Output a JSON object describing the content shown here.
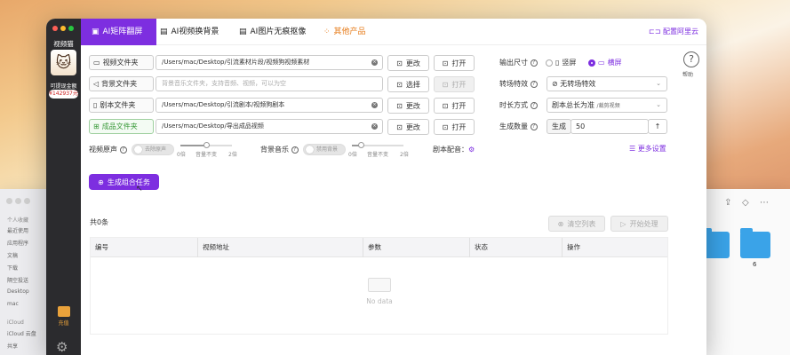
{
  "background_finder": {
    "sidebar": {
      "section_personal": "个人收藏",
      "items": [
        "最近使用",
        "应用程序",
        "文稿",
        "下载",
        "隔空投送",
        "Desktop",
        "mac"
      ],
      "section_icloud": "iCloud",
      "icloud_items": [
        "iCloud 云盘",
        "共享"
      ]
    },
    "folder_label": "6"
  },
  "sidebar": {
    "app_name": "视频猫",
    "balance_label": "可提现金额",
    "balance_value": "¥142937元",
    "charge_label": "充值"
  },
  "tabs": [
    {
      "label": "AI矩阵翻屏",
      "icon": "grid-icon",
      "active": true
    },
    {
      "label": "AI视频换背景",
      "icon": "image-swap-icon"
    },
    {
      "label": "AI图片无痕抠像",
      "icon": "image-cutout-icon"
    },
    {
      "label": "其他产品",
      "icon": "apps-icon"
    }
  ],
  "config_aliyun": "配置阿里云",
  "help_label": "帮助",
  "rows": {
    "video_folder": {
      "label": "视频文件夹",
      "path": "/Users/mac/Desktop/引流素材片段/视频狗视频素材",
      "btn_change": "更改",
      "btn_open": "打开"
    },
    "bgm_folder": {
      "label": "背景文件夹",
      "placeholder": "背景音乐文件夹，支持音频、视频，可以为空",
      "btn_select": "选择",
      "btn_open": "打开"
    },
    "script_folder": {
      "label": "剧本文件夹",
      "path": "/Users/mac/Desktop/引流剧本/视频狗剧本",
      "btn_change": "更改",
      "btn_open": "打开"
    },
    "output_folder": {
      "label": "成品文件夹",
      "path": "/Users/mac/Desktop/导出成品视频",
      "btn_change": "更改",
      "btn_open": "打开"
    }
  },
  "output_size": {
    "label": "输出尺寸",
    "options": [
      "竖屏",
      "横屏"
    ],
    "selected": "横屏"
  },
  "transition": {
    "label": "转场特效",
    "value": "无转场特效"
  },
  "duration_mode": {
    "label": "时长方式",
    "value": "剧本总长为准",
    "value_suffix": "/裁剪视频"
  },
  "gen_count": {
    "label": "生成数量",
    "prefix": "生成",
    "value": "50"
  },
  "audio": {
    "original_label": "视频原声",
    "original_toggle": "去除原声",
    "bgm_label": "背景音乐",
    "bgm_toggle": "禁用背景",
    "tick_labels": [
      "0倍",
      "音量不变",
      "2倍"
    ],
    "original_level": 0.5,
    "bgm_level": 0.18,
    "dub_label": "剧本配音："
  },
  "more_settings": "更多设置",
  "generate_button": "生成组合任务",
  "task_count": "共0条",
  "clear_list": "清空列表",
  "start_process": "开始处理",
  "table": {
    "headers": [
      "编号",
      "视频地址",
      "参数",
      "状态",
      "操作"
    ],
    "empty_text": "No data"
  },
  "colors": {
    "accent": "#7d2ee0",
    "orange": "#e67a17"
  }
}
